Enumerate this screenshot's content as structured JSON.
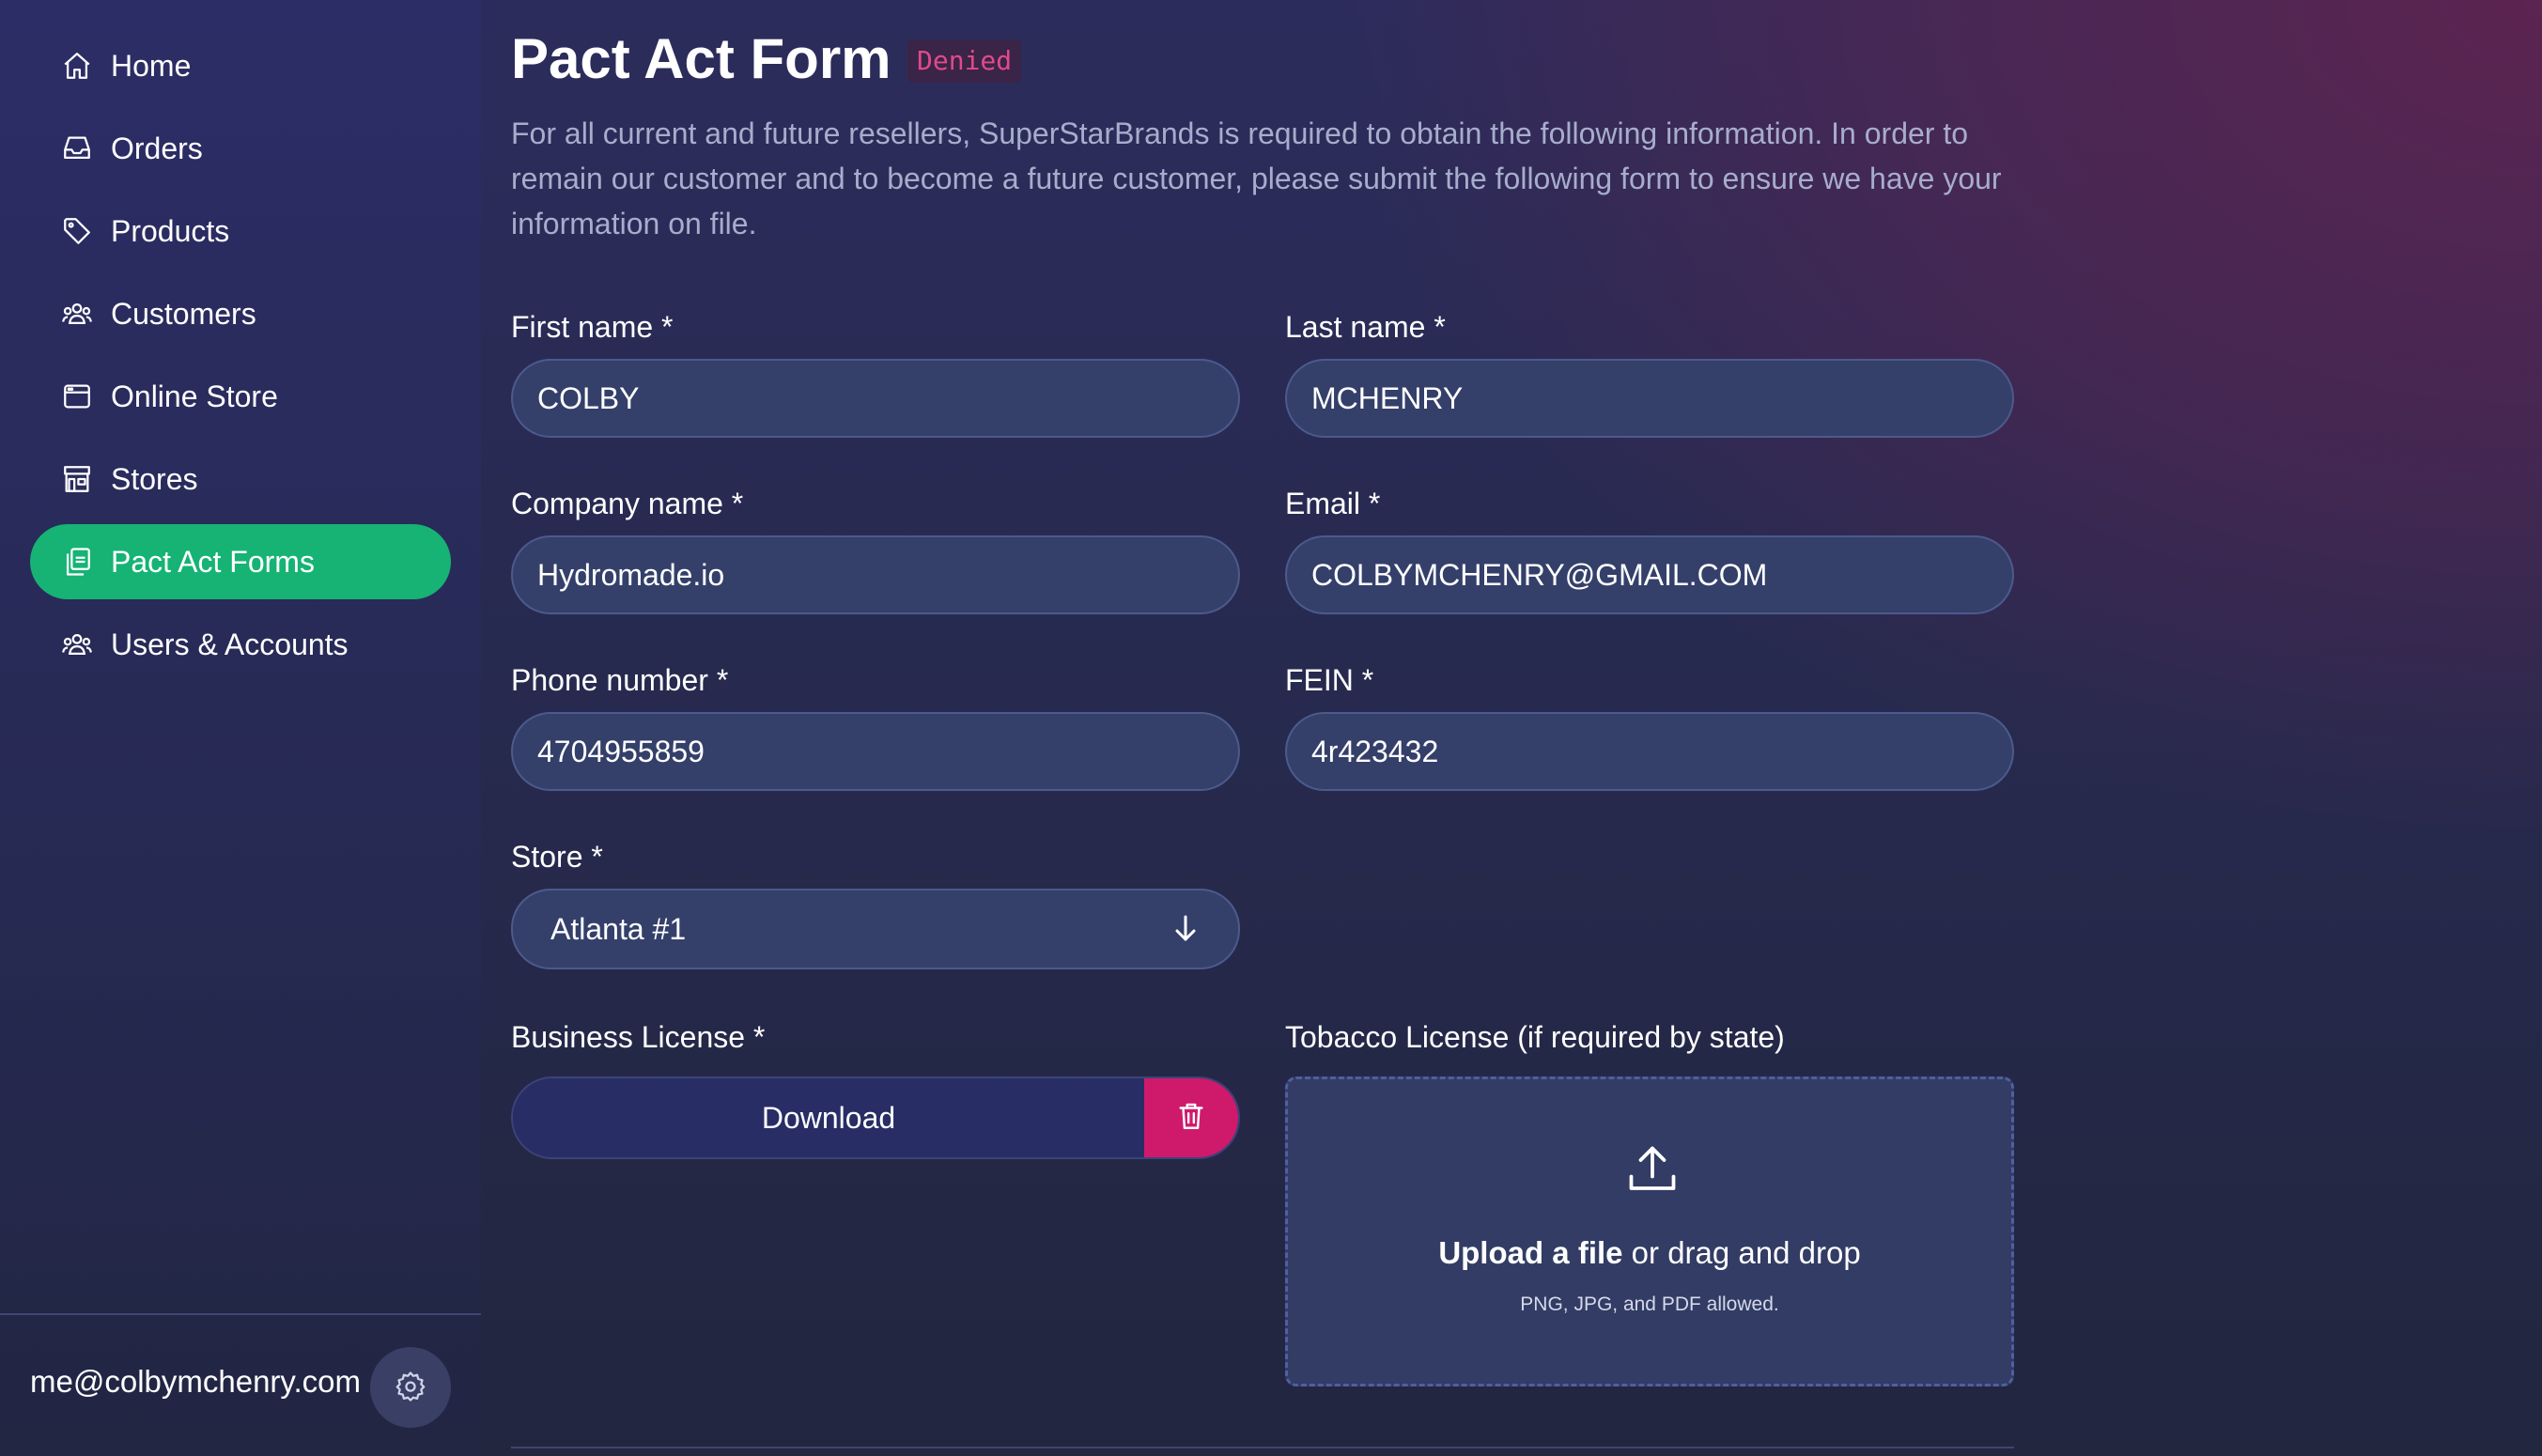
{
  "sidebar": {
    "items": [
      {
        "label": "Home",
        "icon": "home-icon"
      },
      {
        "label": "Orders",
        "icon": "inbox-icon"
      },
      {
        "label": "Products",
        "icon": "tag-icon"
      },
      {
        "label": "Customers",
        "icon": "users-icon"
      },
      {
        "label": "Online Store",
        "icon": "window-icon"
      },
      {
        "label": "Stores",
        "icon": "storefront-icon"
      },
      {
        "label": "Pact Act Forms",
        "icon": "clipboard-icon",
        "active": true
      },
      {
        "label": "Users & Accounts",
        "icon": "users-icon"
      }
    ],
    "user_email": "me@colbymchenry.com",
    "settings_icon": "gear-icon"
  },
  "page": {
    "title": "Pact Act Form",
    "status_badge": "Denied",
    "description": "For all current and future resellers, SuperStarBrands is required to obtain the following information. In order to remain our customer and to become a future customer, please submit the following form to ensure we have your information on file."
  },
  "form": {
    "first_name": {
      "label": "First name *",
      "value": "COLBY"
    },
    "last_name": {
      "label": "Last name *",
      "value": "MCHENRY"
    },
    "company_name": {
      "label": "Company name *",
      "value": "Hydromade.io"
    },
    "email": {
      "label": "Email *",
      "value": "COLBYMCHENRY@GMAIL.COM"
    },
    "phone": {
      "label": "Phone number *",
      "value": "4704955859"
    },
    "fein": {
      "label": "FEIN *",
      "value": "4r423432"
    },
    "store": {
      "label": "Store *",
      "value": "Atlanta #1"
    },
    "business_license": {
      "label": "Business License *",
      "download_label": "Download"
    },
    "tobacco_license": {
      "label": "Tobacco License (if required by state)",
      "upload_link": "Upload a file",
      "upload_rest": " or drag and drop",
      "hint": "PNG, JPG, and PDF allowed."
    }
  },
  "colors": {
    "active_nav": "#16b374",
    "badge_text": "#e04a8a",
    "delete": "#cf1a6c"
  }
}
